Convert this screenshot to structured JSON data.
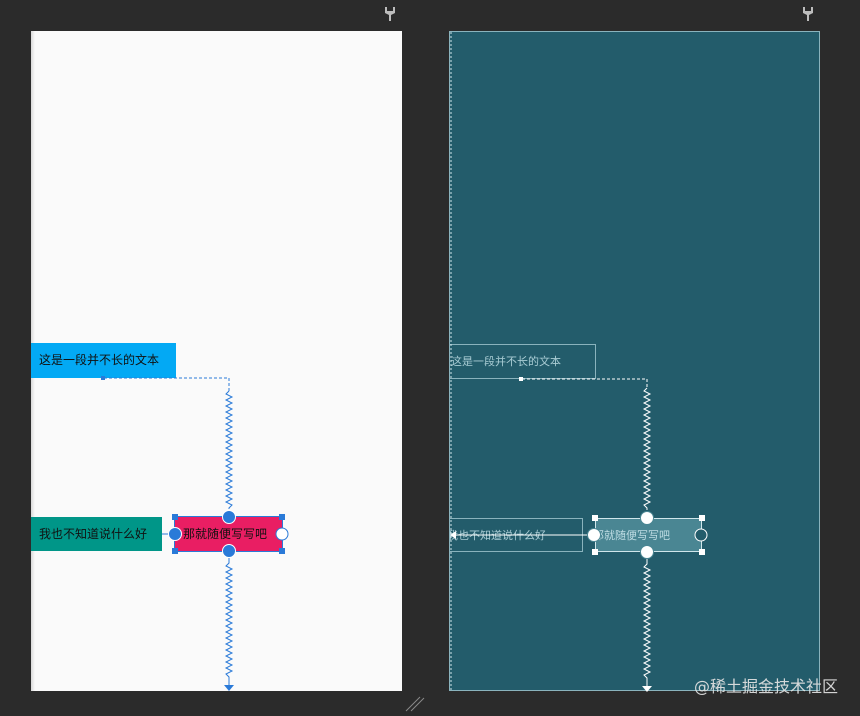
{
  "design_view": {
    "text_long": "这是一段并不长的文本",
    "text_unknown": "我也不知道说什么好",
    "text_random": "那就随便写写吧"
  },
  "blueprint_view": {
    "text_long": "这是一段并不长的文本",
    "text_unknown": "我也不知道说什么好",
    "text_random": "那就随便写写吧"
  },
  "watermark": "@稀土掘金技术社区",
  "icons": [
    "pin-icon",
    "pin-icon",
    "resize-handle-icon"
  ],
  "colors": {
    "background": "#2b2b2b",
    "design_canvas": "#fafafa",
    "blueprint_canvas": "#235c6b",
    "text_long_bg": "#03a9f4",
    "text_unknown_bg": "#009688",
    "text_random_bg": "#e91e63",
    "selection": "#2a7ad8"
  }
}
